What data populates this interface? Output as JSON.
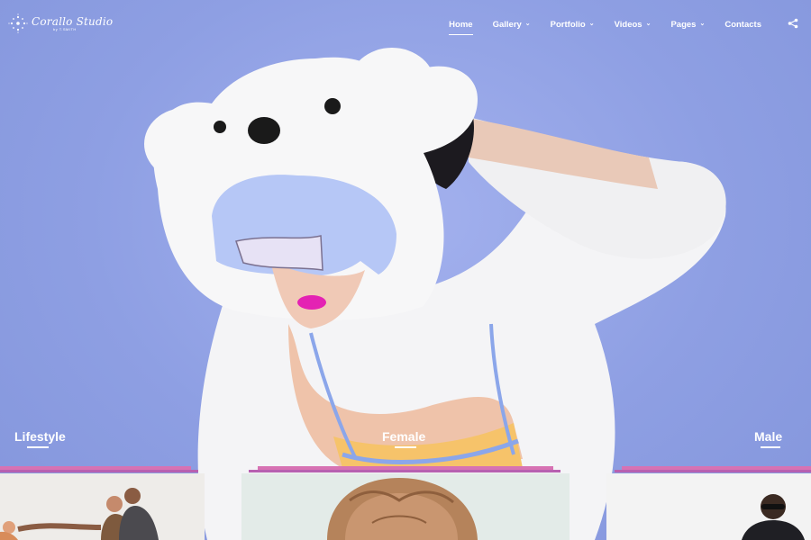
{
  "brand": {
    "name": "Corallo Studio",
    "tagline": "by T.SMITH"
  },
  "nav": {
    "items": [
      {
        "label": "Home",
        "has_dropdown": false,
        "active": true
      },
      {
        "label": "Gallery",
        "has_dropdown": true,
        "active": false
      },
      {
        "label": "Portfolio",
        "has_dropdown": true,
        "active": false
      },
      {
        "label": "Videos",
        "has_dropdown": true,
        "active": false
      },
      {
        "label": "Pages",
        "has_dropdown": true,
        "active": false
      },
      {
        "label": "Contacts",
        "has_dropdown": false,
        "active": false
      }
    ],
    "dropdown_icon": "chevron-down-icon",
    "share_icon": "share-icon"
  },
  "categories": [
    {
      "label": "Lifestyle"
    },
    {
      "label": "Female"
    },
    {
      "label": "Male"
    }
  ],
  "colors": {
    "hero_background": "#8f9fe3",
    "accent_bar": "#d772b3",
    "text": "#ffffff"
  }
}
